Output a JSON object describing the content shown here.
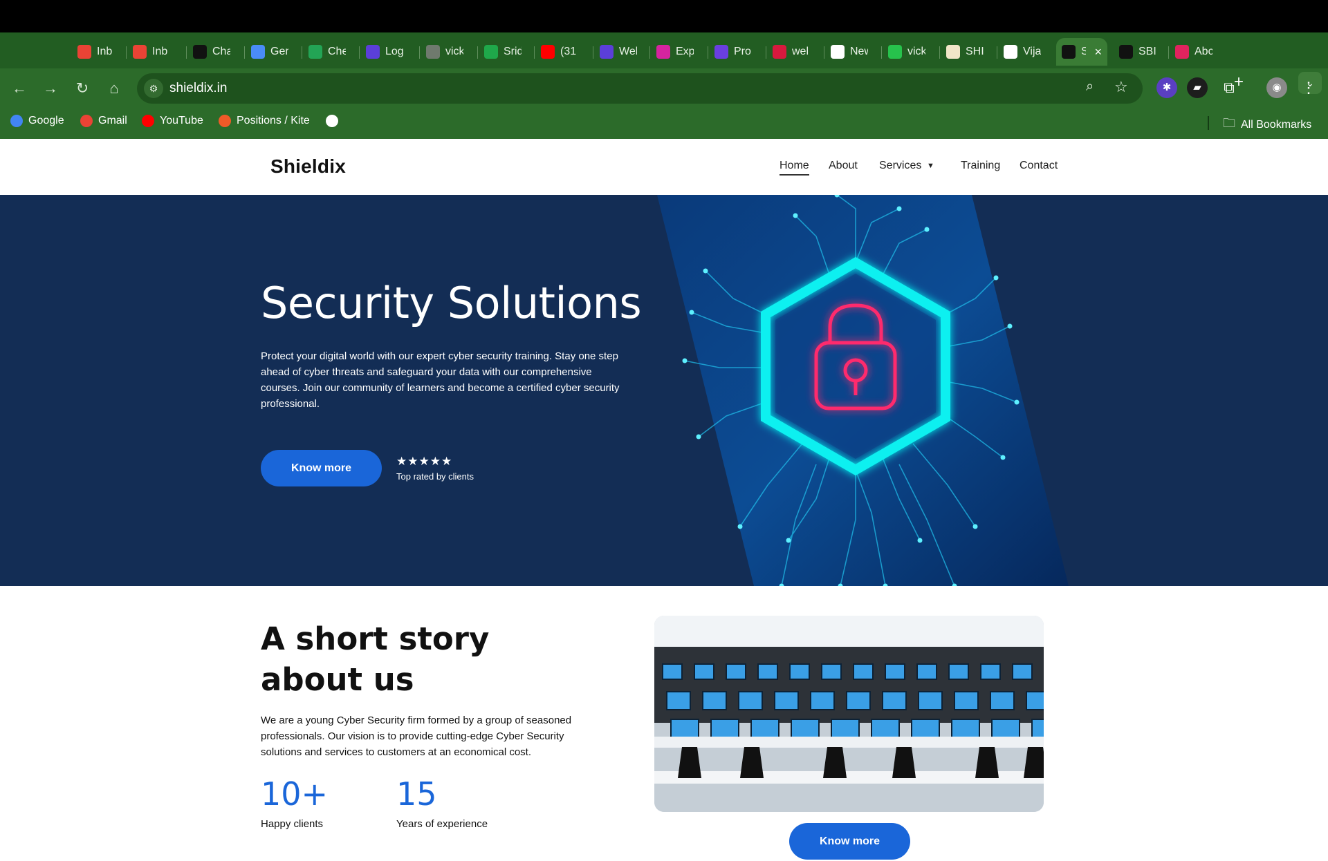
{
  "browser": {
    "tabs": [
      {
        "title": "Inb",
        "icon": "gmail-icon",
        "color": "#ea4335"
      },
      {
        "title": "Inb",
        "icon": "gmail-icon",
        "color": "#ea4335"
      },
      {
        "title": "Cha",
        "icon": "chatgpt-icon",
        "color": "#111111"
      },
      {
        "title": "Ger",
        "icon": "gemini-icon",
        "color": "#4a8cf7"
      },
      {
        "title": "Che",
        "icon": "sheets-icon",
        "color": "#23a455"
      },
      {
        "title": "Log",
        "icon": "hash-logo-icon",
        "color": "#5b3fd9"
      },
      {
        "title": "vick",
        "icon": "globe-icon",
        "color": "#6f7a6e"
      },
      {
        "title": "Srid",
        "icon": "green-badge-icon",
        "color": "#1fa84a"
      },
      {
        "title": "(31",
        "icon": "youtube-icon",
        "color": "#ff0000"
      },
      {
        "title": "Wel",
        "icon": "hash-logo-icon",
        "color": "#5b3fd9"
      },
      {
        "title": "Exp",
        "icon": "instagram-icon",
        "color": "#d6249f"
      },
      {
        "title": "Pro",
        "icon": "hexagon-icon",
        "color": "#6a3fe0"
      },
      {
        "title": "wel",
        "icon": "circle-logo-icon",
        "color": "#d8193e"
      },
      {
        "title": "New",
        "icon": "chrome-icon",
        "color": "#ffffff"
      },
      {
        "title": "vick",
        "icon": "asterisk-icon",
        "color": "#27c24c"
      },
      {
        "title": "SHI",
        "icon": "document-icon",
        "color": "#f1e6c8"
      },
      {
        "title": "Vija",
        "icon": "montana-icon",
        "color": "#ffffff"
      },
      {
        "title": "S",
        "icon": "shieldix-s-icon",
        "color": "#111111",
        "active": true
      },
      {
        "title": "SBI",
        "icon": "shieldix-s-icon",
        "color": "#111111"
      },
      {
        "title": "Abc",
        "icon": "pink-square-icon",
        "color": "#e0245e"
      }
    ],
    "new_tab": "+",
    "url": "shieldix.in",
    "bookmarks": [
      {
        "label": "Google",
        "icon": "google-icon",
        "color": "#4285f4"
      },
      {
        "label": "Gmail",
        "icon": "gmail-icon",
        "color": "#ea4335"
      },
      {
        "label": "YouTube",
        "icon": "youtube-icon",
        "color": "#ff0000"
      },
      {
        "label": "Positions / Kite",
        "icon": "kite-icon",
        "color": "#f05a28"
      },
      {
        "label": "",
        "icon": "globe-icon",
        "color": "#ffffff"
      }
    ],
    "all_bookmarks": "All Bookmarks"
  },
  "site": {
    "logo": "Shieldix",
    "nav": [
      "Home",
      "About",
      "Services",
      "Training",
      "Contact"
    ],
    "hero": {
      "title": "Security Solutions",
      "text": "Protect your digital world with our expert cyber security training. Stay one step ahead of cyber threats and safeguard your data with our comprehensive courses. Join our community of learners and become a certified cyber security professional.",
      "button": "Know more",
      "stars": "★★★★★",
      "rating_label": "Top rated by clients"
    },
    "story": {
      "title": "A short story about us",
      "text": "We are a young Cyber Security firm formed by a group of seasoned professionals. Our vision is to provide cutting-edge Cyber Security solutions and services to customers at an economical cost.",
      "stats": [
        {
          "value": "10+",
          "label": "Happy clients"
        },
        {
          "value": "15",
          "label": "Years of experience"
        }
      ],
      "button": "Know more"
    }
  },
  "colors": {
    "chrome": "#2c6b2a",
    "hero_bg": "#132d55",
    "accent": "#1a66d9",
    "neon_cyan": "#11f0f0",
    "neon_pink": "#ff2a6d"
  }
}
